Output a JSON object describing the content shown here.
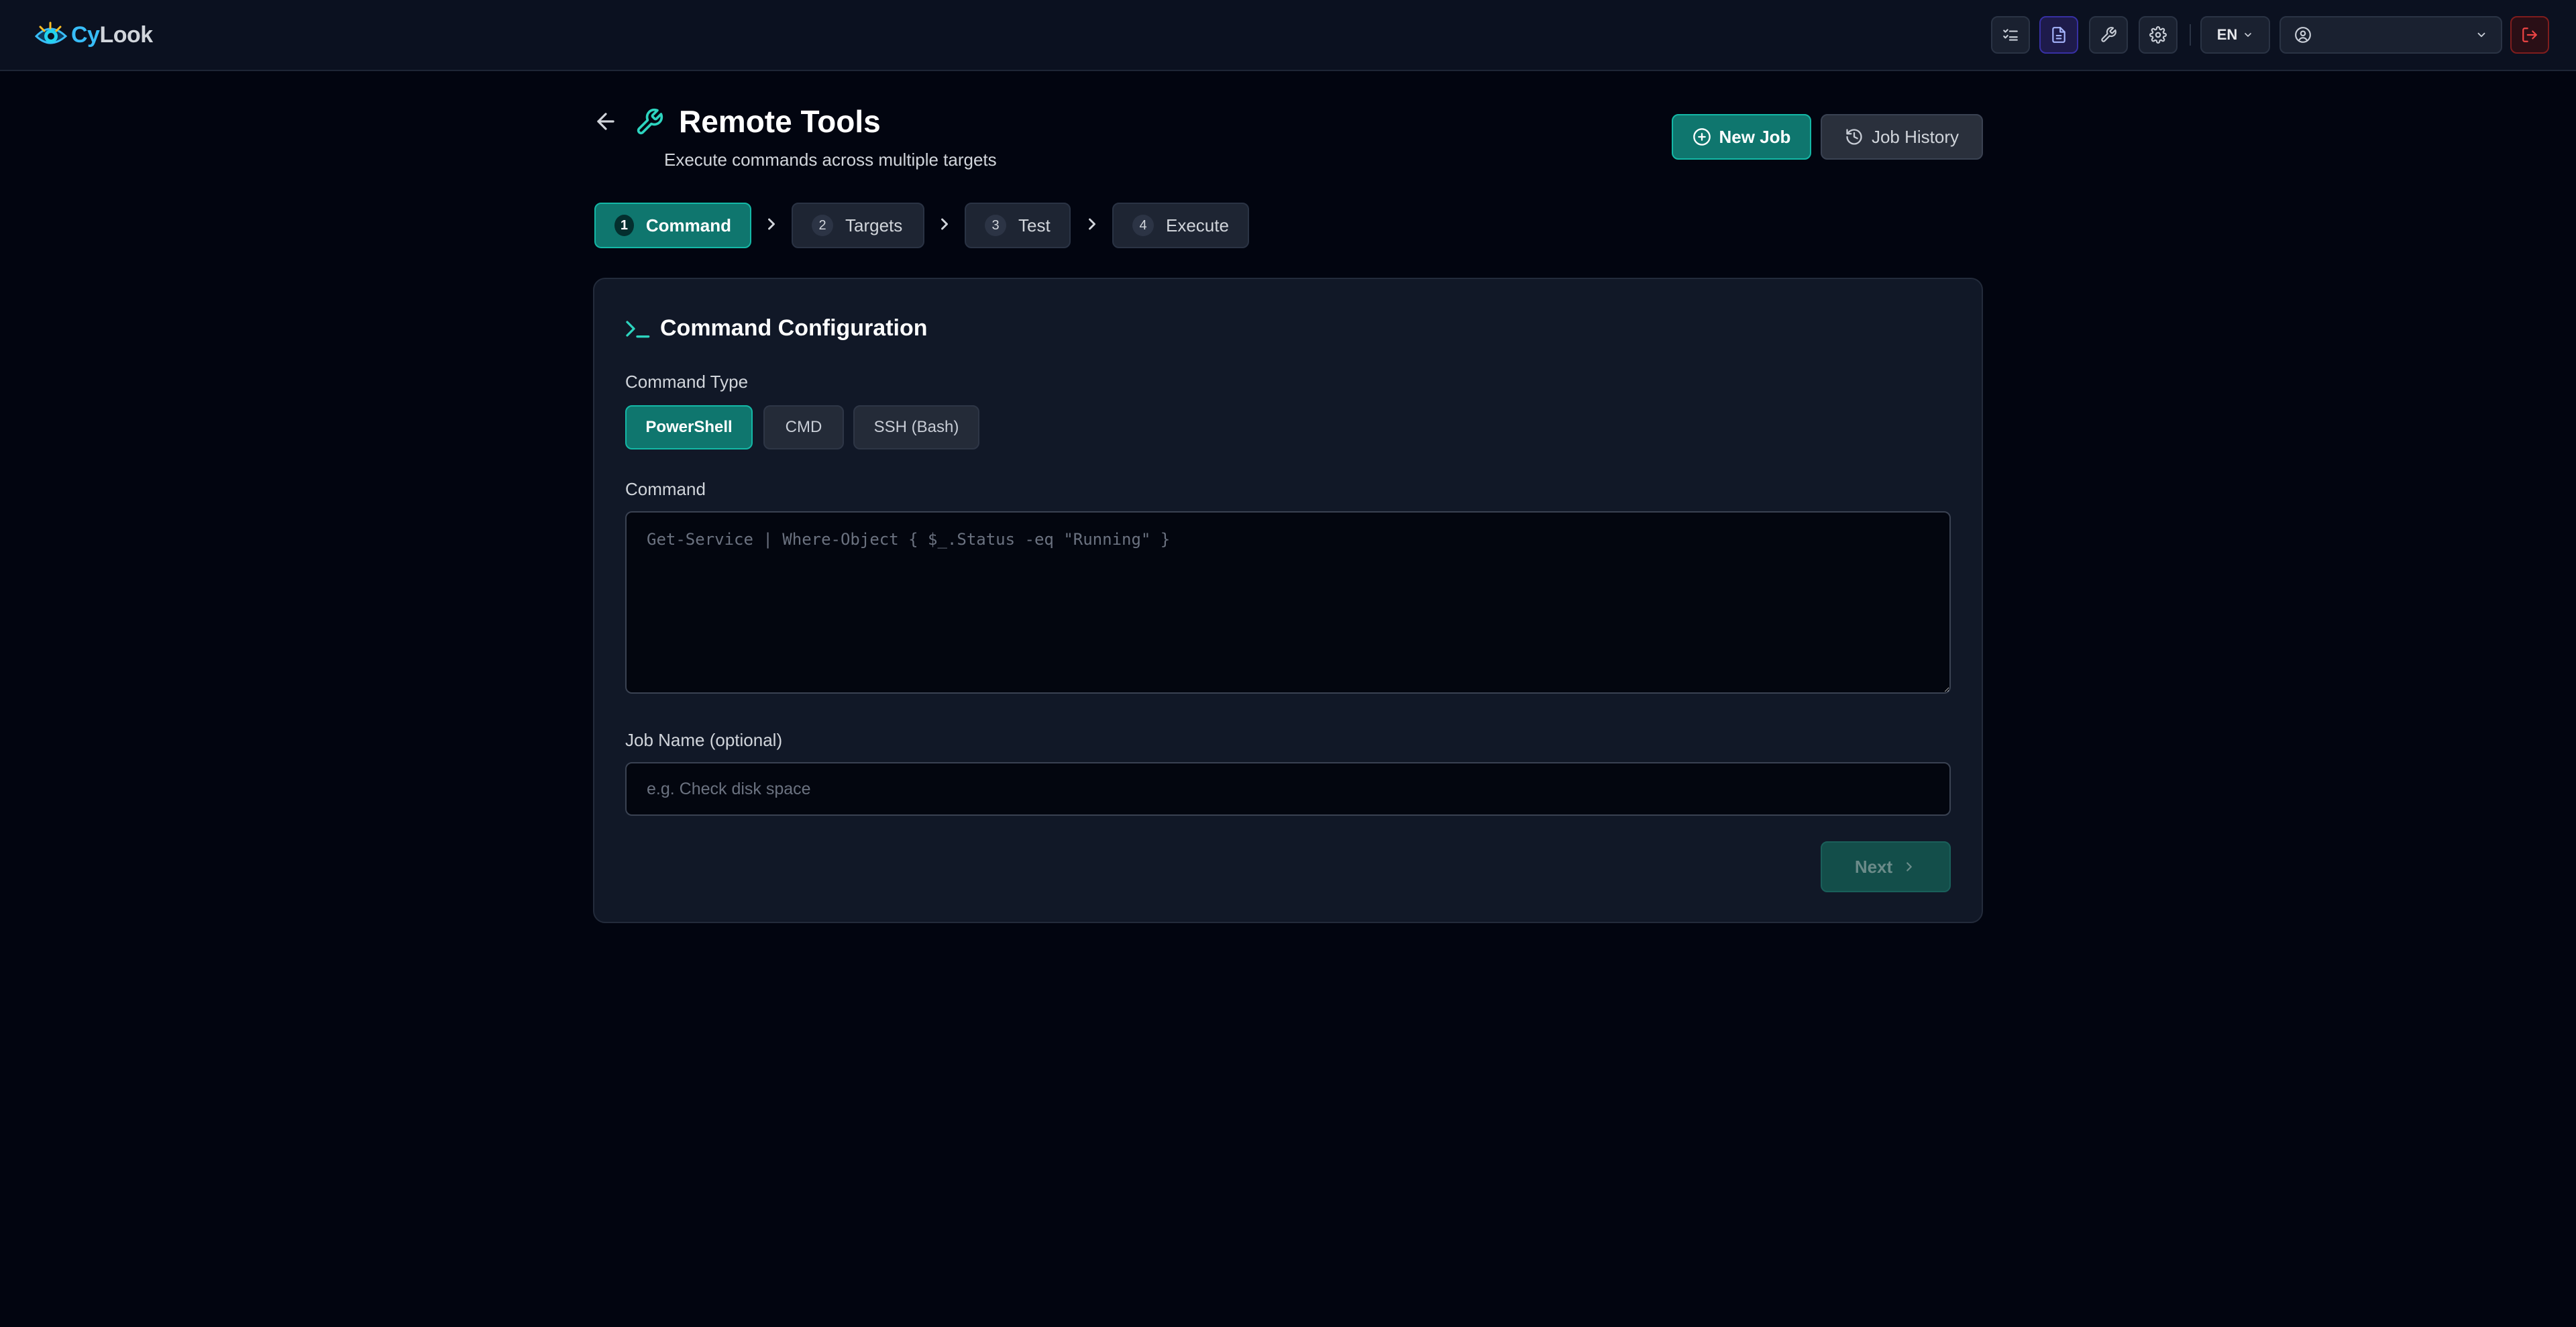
{
  "app": {
    "logo_cy": "Cy",
    "logo_look": "Look"
  },
  "topbar": {
    "icons": [
      "checklist-icon",
      "document-icon",
      "wrench-icon",
      "gear-icon"
    ],
    "language": "EN",
    "user_name": ""
  },
  "header": {
    "title": "Remote Tools",
    "subtitle": "Execute commands across multiple targets",
    "new_job_label": "New Job",
    "job_history_label": "Job History"
  },
  "stepper": {
    "steps": [
      {
        "num": "1",
        "label": "Command"
      },
      {
        "num": "2",
        "label": "Targets"
      },
      {
        "num": "3",
        "label": "Test"
      },
      {
        "num": "4",
        "label": "Execute"
      }
    ],
    "active_index": 0
  },
  "card": {
    "title": "Command Configuration",
    "command_type_label": "Command Type",
    "command_types": [
      "PowerShell",
      "CMD",
      "SSH (Bash)"
    ],
    "selected_type": "PowerShell",
    "command_label": "Command",
    "command_value": "",
    "command_placeholder": "Get-Service | Where-Object { $_.Status -eq \"Running\" }",
    "job_name_label": "Job Name (optional)",
    "job_name_value": "",
    "job_name_placeholder": "e.g. Check disk space",
    "next_label": "Next"
  },
  "colors": {
    "background": "#020510",
    "accent": "#0f766e",
    "accent_border": "#14b8a6",
    "logo_blue": "#38bdf8",
    "logout_red": "#ef4444"
  }
}
